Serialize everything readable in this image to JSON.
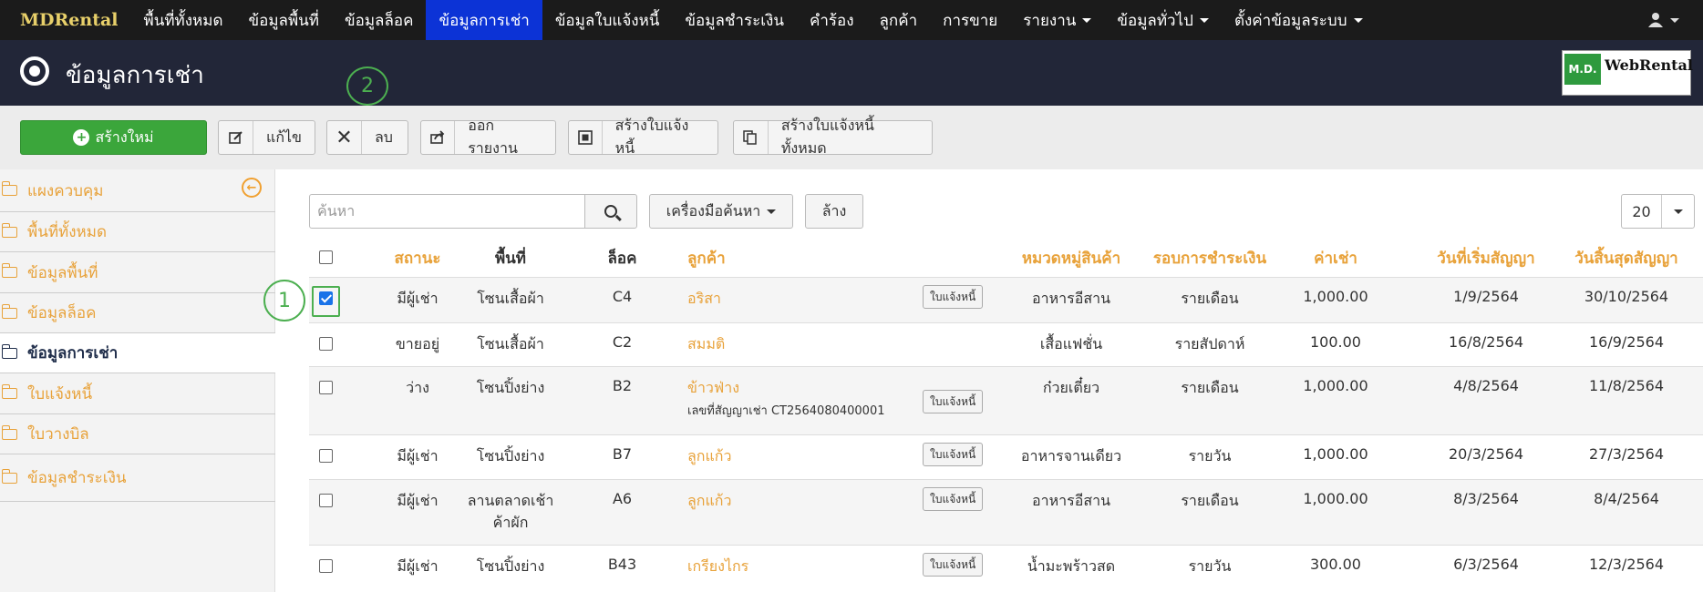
{
  "nav": {
    "brand": "MDRental",
    "items": [
      {
        "label": "พื้นที่ทั้งหมด",
        "active": false,
        "caret": false
      },
      {
        "label": "ข้อมูลพื้นที่",
        "active": false,
        "caret": false
      },
      {
        "label": "ข้อมูลล็อค",
        "active": false,
        "caret": false
      },
      {
        "label": "ข้อมูลการเช่า",
        "active": true,
        "caret": false
      },
      {
        "label": "ข้อมูลใบแจ้งหนี้",
        "active": false,
        "caret": false
      },
      {
        "label": "ข้อมูลชำระเงิน",
        "active": false,
        "caret": false
      },
      {
        "label": "คำร้อง",
        "active": false,
        "caret": false
      },
      {
        "label": "ลูกค้า",
        "active": false,
        "caret": false
      },
      {
        "label": "การขาย",
        "active": false,
        "caret": false
      },
      {
        "label": "รายงาน",
        "active": false,
        "caret": true
      },
      {
        "label": "ข้อมูลทั่วไป",
        "active": false,
        "caret": true
      },
      {
        "label": "ตั้งค่าข้อมูลระบบ",
        "active": false,
        "caret": true
      }
    ],
    "user_icon": "user-icon"
  },
  "header": {
    "title": "ข้อมูลการเช่า",
    "logo_left": "M.D.",
    "logo_right": "WebRental"
  },
  "toolbar": {
    "create": "สร้างใหม่",
    "edit": "แก้ไข",
    "delete": "ลบ",
    "export": "ออกรายงาน",
    "invoice": "สร้างใบแจ้งหนี้",
    "invoice_all": "สร้างใบแจ้งหนี้ทั้งหมด"
  },
  "sidebar": {
    "items": [
      {
        "label": "แผงควบคุม",
        "active": false
      },
      {
        "label": "พื้นที่ทั้งหมด",
        "active": false
      },
      {
        "label": "ข้อมูลพื้นที่",
        "active": false
      },
      {
        "label": "ข้อมูลล็อค",
        "active": false
      },
      {
        "label": "ข้อมูลการเช่า",
        "active": true
      },
      {
        "label": "ใบแจ้งหนี้",
        "active": false
      },
      {
        "label": "ใบวางบิล",
        "active": false
      },
      {
        "label": "ข้อมูลชำระเงิน",
        "active": false
      }
    ]
  },
  "search": {
    "placeholder": "ค้นหา",
    "tools": "เครื่องมือค้นหา",
    "clear": "ล้าง",
    "page_size": "20"
  },
  "table": {
    "headers": {
      "status": "สถานะ",
      "area": "พื้นที่",
      "lock": "ล็อค",
      "customer": "ลูกค้า",
      "category": "หมวดหมู่สินค้า",
      "cycle": "รอบการชำระเงิน",
      "rent": "ค่าเช่า",
      "start": "วันที่เริ่มสัญญา",
      "end": "วันสิ้นสุดสัญญา"
    },
    "invoice_label": "ใบแจ้งหนี้",
    "rows": [
      {
        "checked": true,
        "status": "มีผู้เช่า",
        "area": "โซนเสื้อผ้า",
        "area2": "",
        "lock": "C4",
        "customer": "อริสา",
        "contract": "",
        "invoice": true,
        "category": "อาหารอีสาน",
        "cycle": "รายเดือน",
        "rent": "1,000.00",
        "start": "1/9/2564",
        "end": "30/10/2564"
      },
      {
        "checked": false,
        "status": "ขายอยู่",
        "area": "โซนเสื้อผ้า",
        "area2": "",
        "lock": "C2",
        "customer": "สมมติ",
        "contract": "",
        "invoice": false,
        "category": "เสื้อแฟชั่น",
        "cycle": "รายสัปดาห์",
        "rent": "100.00",
        "start": "16/8/2564",
        "end": "16/9/2564"
      },
      {
        "checked": false,
        "status": "ว่าง",
        "area": "โซนปิ้งย่าง",
        "area2": "",
        "lock": "B2",
        "customer": "ข้าวฟ่าง",
        "contract": "เลขที่สัญญาเช่า CT2564080400001",
        "invoice": true,
        "category": "ก๋วยเตี๋ยว",
        "cycle": "รายเดือน",
        "rent": "1,000.00",
        "start": "4/8/2564",
        "end": "11/8/2564"
      },
      {
        "checked": false,
        "status": "มีผู้เช่า",
        "area": "โซนปิ้งย่าง",
        "area2": "",
        "lock": "B7",
        "customer": "ลูกแก้ว",
        "contract": "",
        "invoice": true,
        "category": "อาหารจานเดียว",
        "cycle": "รายวัน",
        "rent": "1,000.00",
        "start": "20/3/2564",
        "end": "27/3/2564"
      },
      {
        "checked": false,
        "status": "มีผู้เช่า",
        "area": "ลานตลาดเช้า",
        "area2": "ค้าผัก",
        "lock": "A6",
        "customer": "ลูกแก้ว",
        "contract": "",
        "invoice": true,
        "category": "อาหารอีสาน",
        "cycle": "รายเดือน",
        "rent": "1,000.00",
        "start": "8/3/2564",
        "end": "8/4/2564"
      },
      {
        "checked": false,
        "status": "มีผู้เช่า",
        "area": "โซนปิ้งย่าง",
        "area2": "",
        "lock": "B43",
        "customer": "เกรียงไกร",
        "contract": "",
        "invoice": true,
        "category": "น้ำมะพร้าวสด",
        "cycle": "รายวัน",
        "rent": "300.00",
        "start": "6/3/2564",
        "end": "12/3/2564"
      }
    ]
  },
  "annotations": {
    "one": "1",
    "two": "2"
  }
}
